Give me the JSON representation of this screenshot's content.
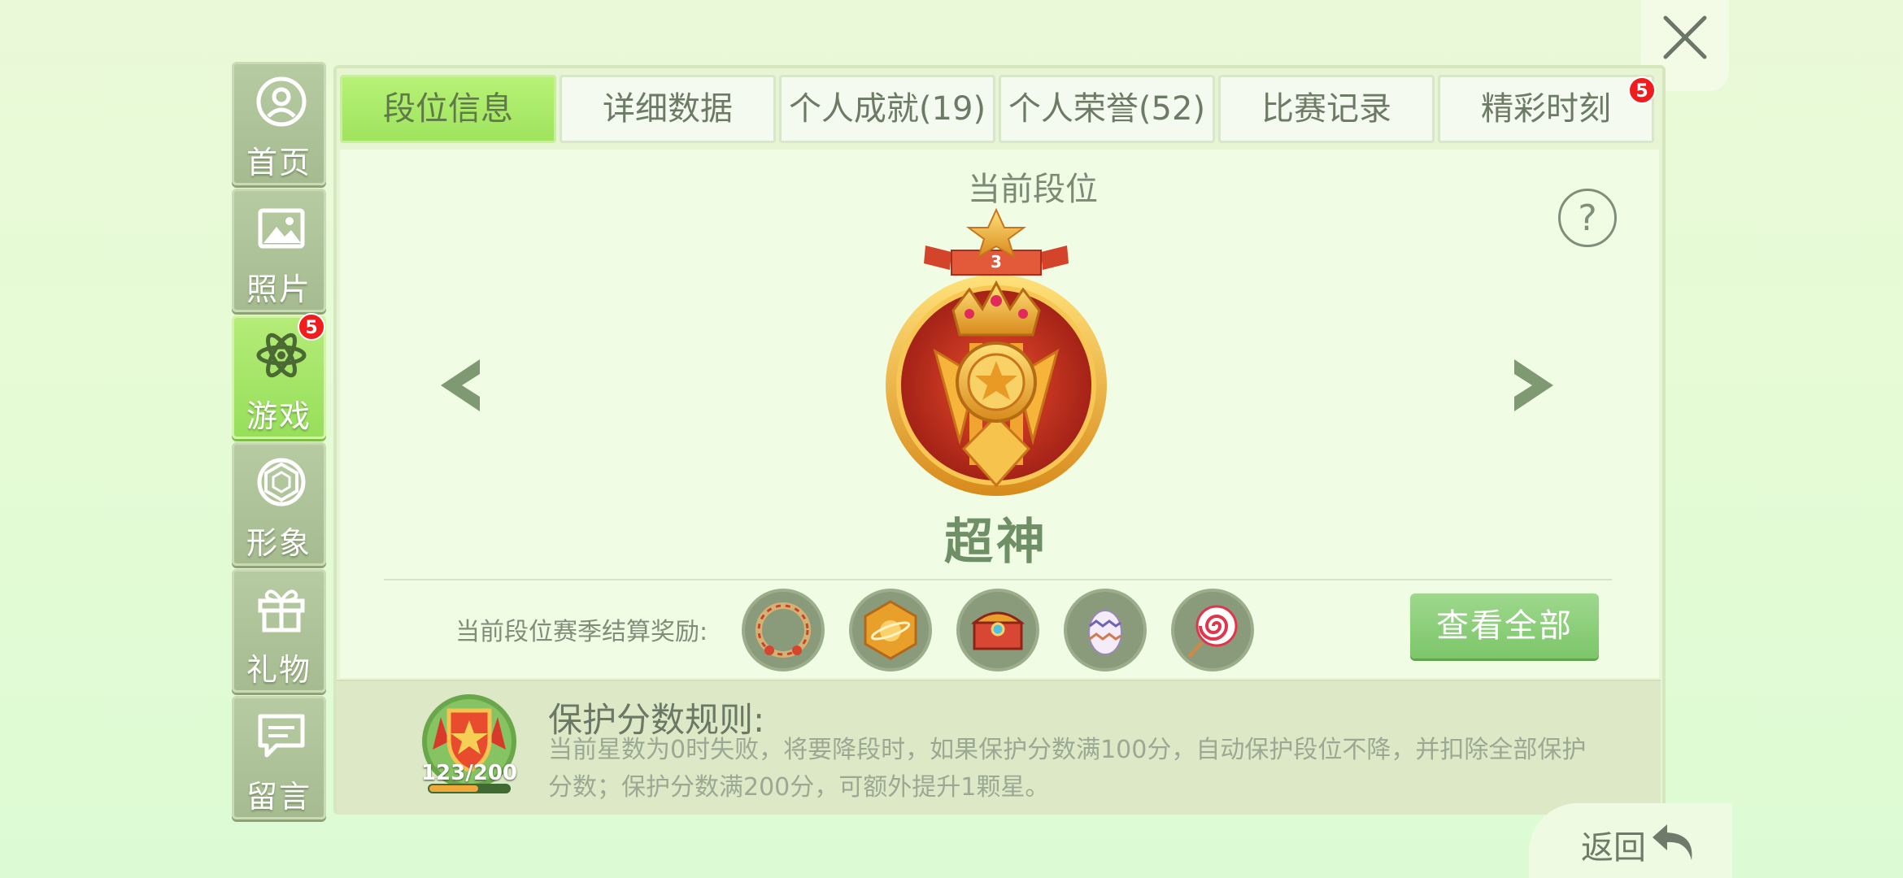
{
  "sidebar": {
    "items": [
      {
        "label": "首页",
        "icon": "user-icon"
      },
      {
        "label": "照片",
        "icon": "image-icon"
      },
      {
        "label": "游戏",
        "icon": "atom-icon",
        "badge": "5",
        "active": true
      },
      {
        "label": "形象",
        "icon": "diamond-icon"
      },
      {
        "label": "礼物",
        "icon": "gift-icon"
      },
      {
        "label": "留言",
        "icon": "message-icon"
      }
    ]
  },
  "tabs": [
    {
      "label": "段位信息",
      "active": true
    },
    {
      "label": "详细数据"
    },
    {
      "label": "个人成就(19)"
    },
    {
      "label": "个人荣誉(52)"
    },
    {
      "label": "比赛记录"
    },
    {
      "label": "精彩时刻",
      "badge": "5"
    }
  ],
  "rank": {
    "title": "当前段位",
    "stars": "3",
    "name": "超神",
    "help": "?"
  },
  "rewards": {
    "label": "当前段位赛季结算奖励:",
    "items": [
      "avatar-frame-icon",
      "planet-badge-icon",
      "treasure-chest-icon",
      "egg-icon",
      "lollipop-icon"
    ],
    "view_all": "查看全部"
  },
  "protection": {
    "title": "保护分数规则:",
    "text": "当前星数为0时失败，将要降段时，如果保护分数满100分，自动保护段位不降，并扣除全部保护分数；保护分数满200分，可额外提升1颗星。",
    "count": "123/200",
    "progress": 0.615
  },
  "back_label": "返回",
  "colors": {
    "accent_green": "#9fe35e",
    "badge_red": "#ef1d1d",
    "rank_red": "#c9361f",
    "rank_gold": "#f2b53a"
  }
}
